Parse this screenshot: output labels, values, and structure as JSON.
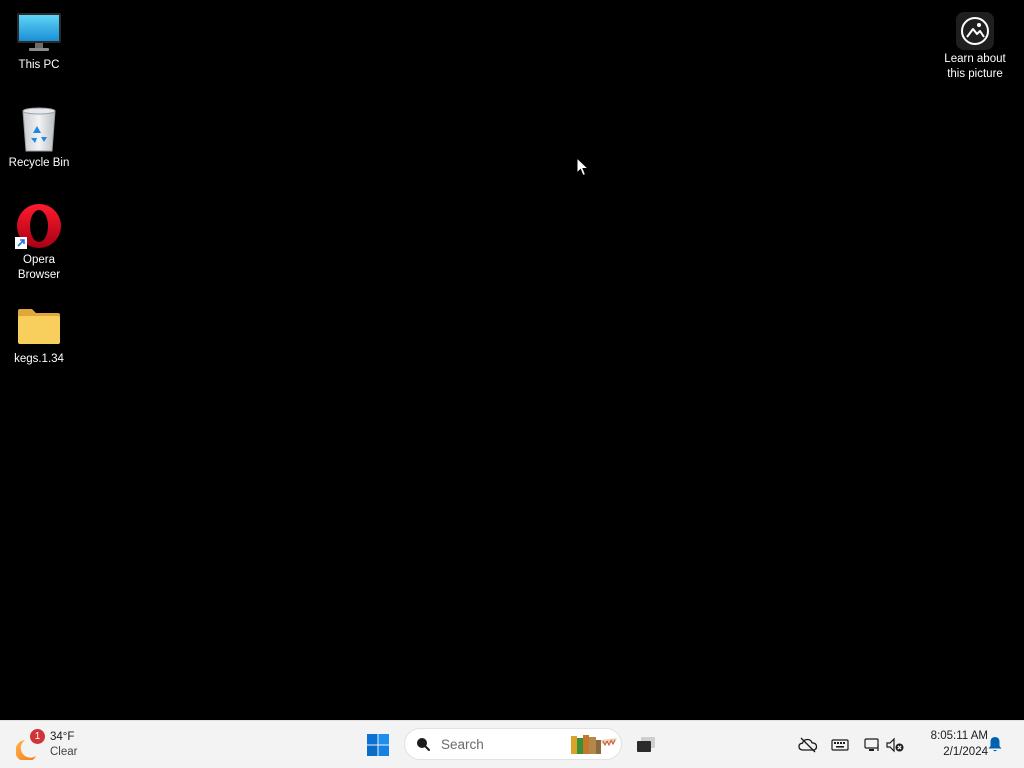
{
  "desktop": {
    "icons": [
      {
        "label": "This PC",
        "icon": "monitor-icon"
      },
      {
        "label": "Recycle Bin",
        "icon": "recycle-bin-icon"
      },
      {
        "label": "Opera Browser",
        "icon": "opera-icon"
      },
      {
        "label": "kegs.1.34",
        "icon": "folder-icon"
      }
    ],
    "spotlight": {
      "label_line1": "Learn about",
      "label_line2": "this picture",
      "icon": "spotlight-camera-icon"
    }
  },
  "taskbar": {
    "weather": {
      "badge": "1",
      "temp": "34°F",
      "condition": "Clear",
      "icon": "weather-moon-icon"
    },
    "start": {
      "icon": "windows-start-icon"
    },
    "search": {
      "placeholder": "Search",
      "icon": "search-icon"
    },
    "task_view": {
      "icon": "task-view-icon"
    },
    "tray": {
      "icons": [
        "onedrive-offline-icon",
        "keyboard-icon",
        "network-icon",
        "volume-muted-icon"
      ]
    },
    "clock": {
      "time": "8:05:11 AM",
      "date": "2/1/2024"
    },
    "notifications": {
      "icon": "bell-icon"
    }
  },
  "colors": {
    "desktop_background": "#000000",
    "taskbar_background": "#f3f3f3",
    "start_blue": "#0078d4",
    "opera_red": "#e3192a",
    "folder_yellow": "#f5c64c"
  }
}
